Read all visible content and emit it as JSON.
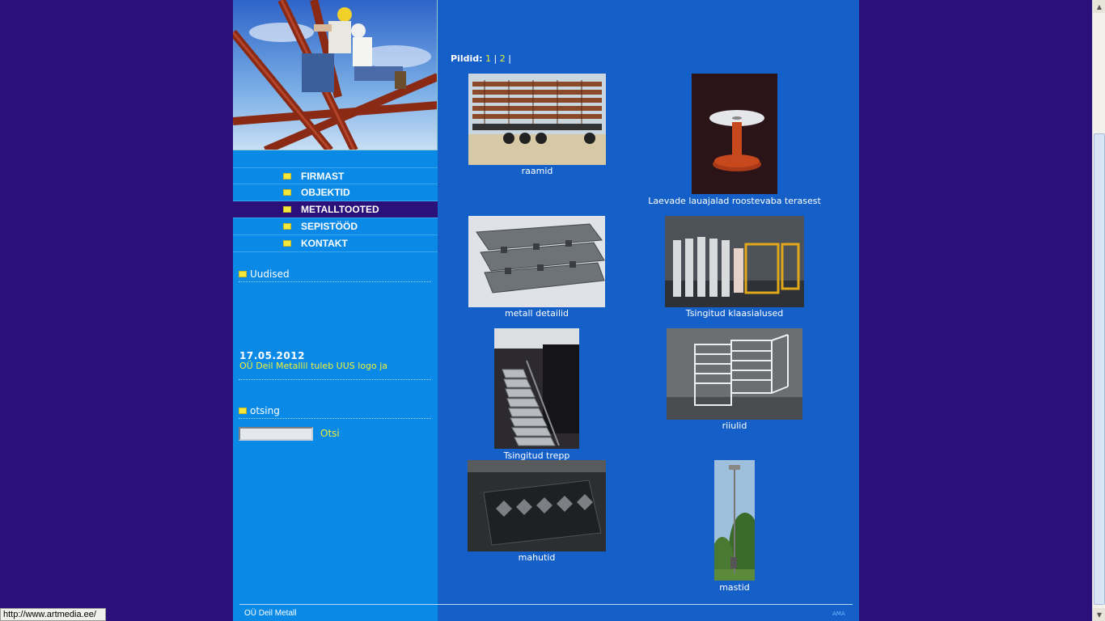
{
  "nav": {
    "items": [
      {
        "label": "FIRMAST"
      },
      {
        "label": "OBJEKTID"
      },
      {
        "label": "METALLTOOTED"
      },
      {
        "label": "SEPISTÖÖD"
      },
      {
        "label": "KONTAKT"
      }
    ]
  },
  "news": {
    "title": "Uudised",
    "date": "17.05.2012",
    "text": "OÜ Deil Metallil tuleb UUS logo ja"
  },
  "search": {
    "title": "otsing",
    "value": "",
    "button": "Otsi"
  },
  "gallery": {
    "label": "Pildid:",
    "pages": [
      "1",
      "2"
    ],
    "sep": "|",
    "items": [
      {
        "caption": "raamid"
      },
      {
        "caption": "Laevade lauajalad roostevaba terasest"
      },
      {
        "caption": "metall detailid"
      },
      {
        "caption": "Tsingitud klaasialused"
      },
      {
        "caption": "Tsingitud trepp"
      },
      {
        "caption": "riiulid"
      },
      {
        "caption": "mahutid"
      },
      {
        "caption": "mastid"
      }
    ]
  },
  "footer": {
    "company": "OÜ Deil Metall",
    "credit": "AMA"
  },
  "status": {
    "url": "http://www.artmedia.ee/"
  },
  "colors": {
    "background": "#2a1078",
    "content": "#1460c8",
    "sidebar": "#0a8ae6",
    "link": "#f0f03a"
  }
}
